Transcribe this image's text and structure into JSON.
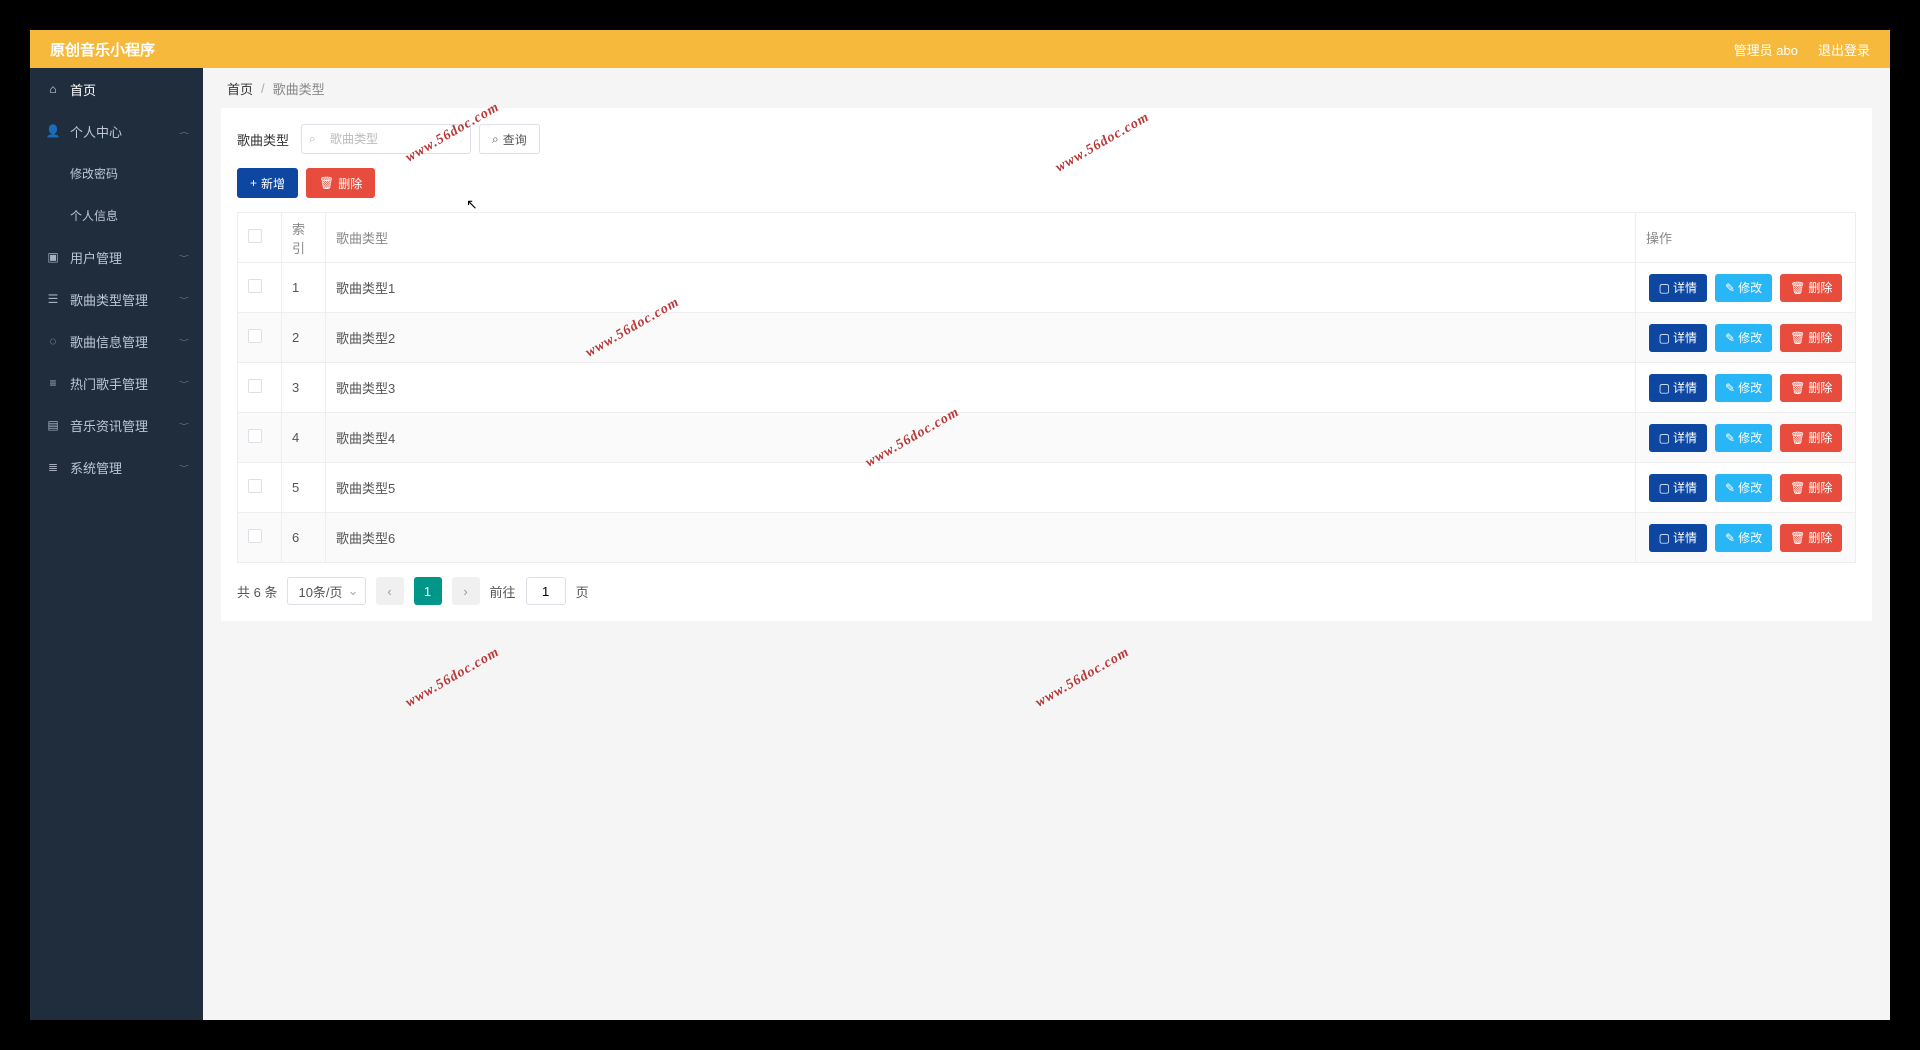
{
  "header": {
    "title": "原创音乐小程序",
    "admin": "管理员 abo",
    "logout": "退出登录"
  },
  "sidebar": {
    "home": "首页",
    "personal": "个人中心",
    "changePwd": "修改密码",
    "personalInfo": "个人信息",
    "userMgmt": "用户管理",
    "songTypeMgmt": "歌曲类型管理",
    "songInfoMgmt": "歌曲信息管理",
    "hotSingerMgmt": "热门歌手管理",
    "musicNewsMgmt": "音乐资讯管理",
    "systemMgmt": "系统管理"
  },
  "breadcrumb": {
    "home": "首页",
    "sep": "/",
    "current": "歌曲类型"
  },
  "search": {
    "label": "歌曲类型",
    "placeholder": "歌曲类型",
    "queryBtn": "查询"
  },
  "actions": {
    "add": "新增",
    "delete": "删除"
  },
  "table": {
    "headers": {
      "index": "索引",
      "type": "歌曲类型",
      "ops": "操作"
    },
    "rows": [
      {
        "idx": "1",
        "type": "歌曲类型1"
      },
      {
        "idx": "2",
        "type": "歌曲类型2"
      },
      {
        "idx": "3",
        "type": "歌曲类型3"
      },
      {
        "idx": "4",
        "type": "歌曲类型4"
      },
      {
        "idx": "5",
        "type": "歌曲类型5"
      },
      {
        "idx": "6",
        "type": "歌曲类型6"
      }
    ],
    "rowOps": {
      "detail": "详情",
      "edit": "修改",
      "delete": "删除"
    }
  },
  "pagination": {
    "total": "共 6 条",
    "pageSize": "10条/页",
    "prev": "‹",
    "current": "1",
    "next": "›",
    "gotoPrefix": "前往",
    "gotoValue": "1",
    "gotoSuffix": "页"
  },
  "watermark": "www.56doc.com"
}
